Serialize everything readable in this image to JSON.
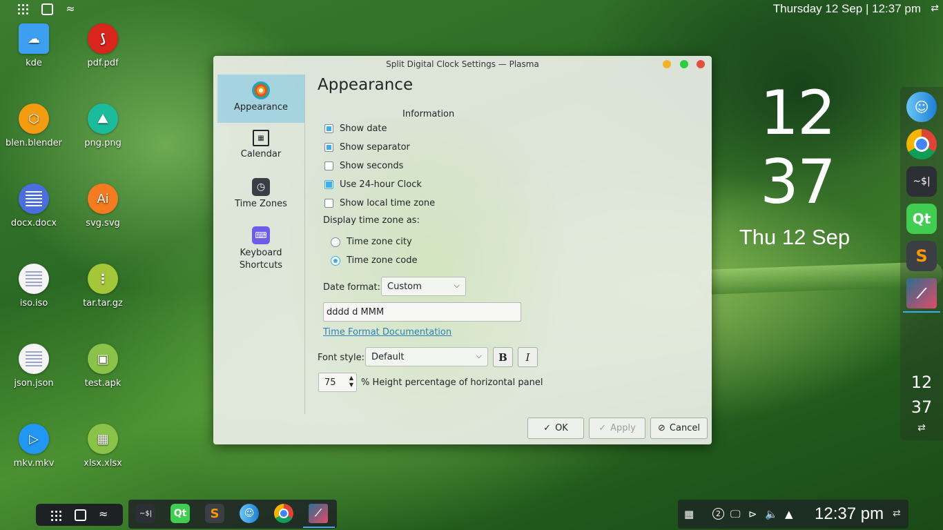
{
  "topbar": {
    "clock": "Thursday 12 Sep | 12:37 pm"
  },
  "desktop": {
    "icons": [
      {
        "label": "kde",
        "color": "#3d9ff0"
      },
      {
        "label": "pdf.pdf",
        "color": "#d9261c"
      },
      {
        "label": "blen.blender",
        "color": "#f39c12"
      },
      {
        "label": "png.png",
        "color": "#1abc9c"
      },
      {
        "label": "docx.docx",
        "color": "#4a6ee0"
      },
      {
        "label": "svg.svg",
        "color": "#f47b20"
      },
      {
        "label": "iso.iso",
        "color": "#f5f5f5"
      },
      {
        "label": "tar.tar.gz",
        "color": "#a4c639"
      },
      {
        "label": "json.json",
        "color": "#f5f5f5"
      },
      {
        "label": "test.apk",
        "color": "#8bc34a"
      },
      {
        "label": "mkv.mkv",
        "color": "#2196f3"
      },
      {
        "label": "xlsx.xlsx",
        "color": "#8bc34a"
      }
    ],
    "svg_tile_text": "Ai"
  },
  "big_clock": {
    "hours": "12",
    "minutes": "37",
    "date": "Thu 12 Sep"
  },
  "right_dock": {
    "apps": [
      "finder-icon",
      "chrome-icon",
      "terminal-icon",
      "qt-creator-icon",
      "sublime-icon",
      "kdenlive-icon"
    ],
    "terminal_text": "~$|",
    "qt_text": "Qt",
    "sublime_text": "S",
    "clock_hours": "12",
    "clock_minutes": "37"
  },
  "taskbar": {
    "apps": [
      "terminal-icon",
      "qt-creator-icon",
      "sublime-icon",
      "finder-icon",
      "chrome-icon",
      "kdenlive-icon"
    ],
    "terminal_text": "~$|",
    "qt_text": "Qt",
    "sublime_text": "S",
    "tray_badge": "2",
    "clock": "12:37 pm"
  },
  "dialog": {
    "title": "Split Digital Clock Settings — Plasma",
    "sidebar": [
      {
        "label": "Appearance",
        "active": true
      },
      {
        "label": "Calendar",
        "active": false
      },
      {
        "label": "Time Zones",
        "active": false
      },
      {
        "label": "Keyboard Shortcuts",
        "active": false
      }
    ],
    "page_title": "Appearance",
    "section_label": "Information",
    "checkboxes": [
      {
        "label": "Show date",
        "checked": true
      },
      {
        "label": "Show separator",
        "checked": true
      },
      {
        "label": "Show seconds",
        "checked": false
      },
      {
        "label": "Use 24-hour Clock",
        "checked": true
      },
      {
        "label": "Show local time zone",
        "checked": false
      }
    ],
    "timezone_label": "Display time zone as:",
    "radios": [
      {
        "label": "Time zone city",
        "selected": false
      },
      {
        "label": "Time zone code",
        "selected": true
      }
    ],
    "date_format_label": "Date format:",
    "date_format_value": "Custom",
    "date_format_text": "dddd d MMM",
    "doc_link": "Time Format Documentation",
    "font_style_label": "Font style:",
    "font_style_value": "Default",
    "bold_label": "B",
    "italic_label": "I",
    "height_value": "75",
    "height_label": "% Height percentage of horizontal panel",
    "buttons": {
      "ok": "OK",
      "apply": "Apply",
      "cancel": "Cancel"
    },
    "accent": "#3daee9"
  }
}
